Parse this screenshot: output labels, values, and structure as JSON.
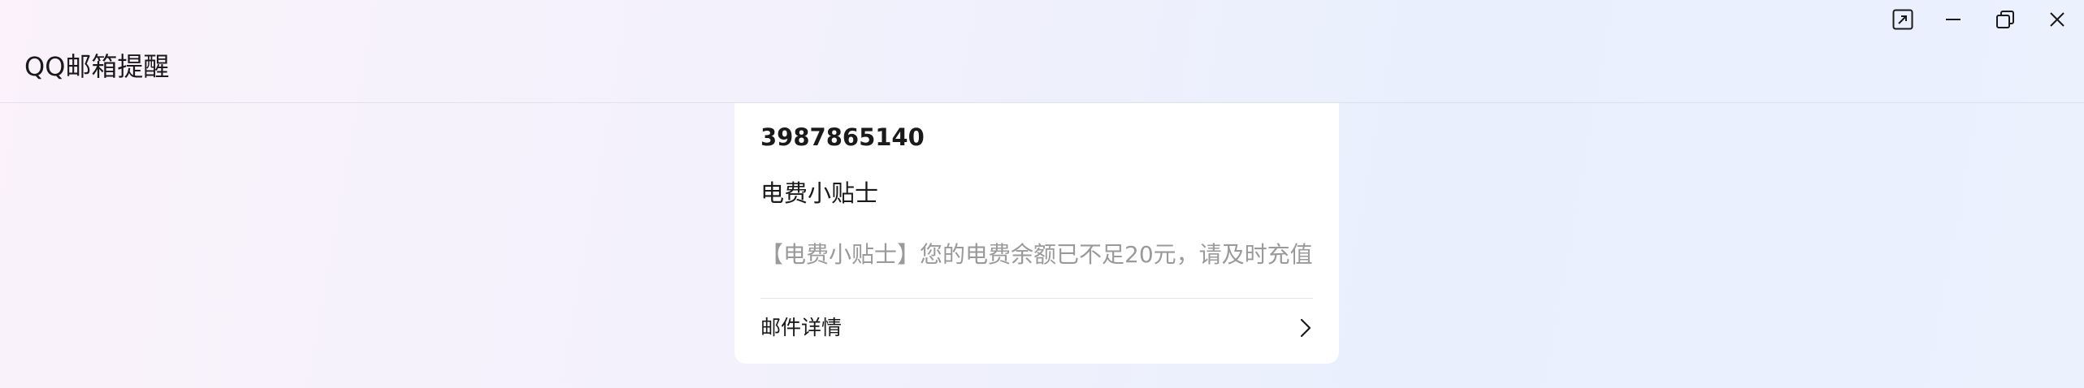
{
  "window": {
    "title": "QQ邮箱提醒",
    "controls": {
      "pin_icon": "pin-window-icon",
      "minimize_icon": "minimize-icon",
      "restore_icon": "restore-icon",
      "close_icon": "close-icon"
    }
  },
  "notification": {
    "sender": "3987865140",
    "subject": "电费小贴士",
    "preview": "【电费小贴士】您的电费余额已不足20元，请及时充值",
    "details_label": "邮件详情",
    "details_icon": "chevron-right-icon"
  },
  "colors": {
    "card_background": "#ffffff",
    "preview_text": "#9a9a9a",
    "primary_text": "#1a1a1a"
  }
}
